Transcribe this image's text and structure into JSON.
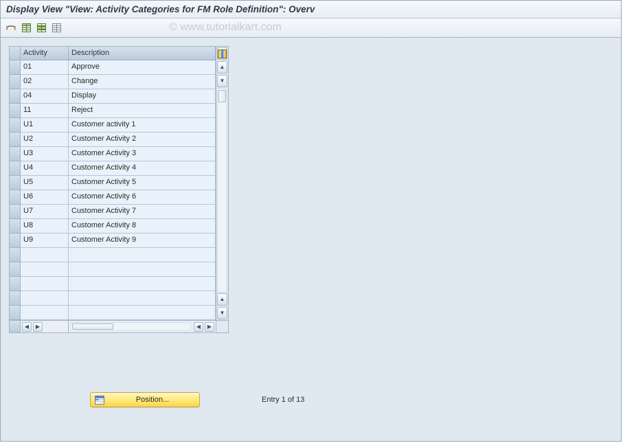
{
  "title": "Display View \"View: Activity Categories for FM Role Definition\": Overv",
  "watermark": "© www.tutorialkart.com",
  "toolbar": {
    "icons": [
      {
        "name": "toggle-display-change-icon"
      },
      {
        "name": "select-all-icon"
      },
      {
        "name": "deselect-all-icon"
      },
      {
        "name": "table-settings-icon"
      }
    ]
  },
  "table": {
    "columns": {
      "activity": "Activity",
      "description": "Description"
    },
    "rows": [
      {
        "activity": "01",
        "description": "Approve"
      },
      {
        "activity": "02",
        "description": "Change"
      },
      {
        "activity": "04",
        "description": "Display"
      },
      {
        "activity": "11",
        "description": "Reject"
      },
      {
        "activity": "U1",
        "description": "Customer activity 1"
      },
      {
        "activity": "U2",
        "description": "Customer Activity 2"
      },
      {
        "activity": "U3",
        "description": "Customer Activity 3"
      },
      {
        "activity": "U4",
        "description": "Customer Activity 4"
      },
      {
        "activity": "U5",
        "description": "Customer Activity 5"
      },
      {
        "activity": "U6",
        "description": "Customer Activity 6"
      },
      {
        "activity": "U7",
        "description": "Customer Activity 7"
      },
      {
        "activity": "U8",
        "description": "Customer Activity 8"
      },
      {
        "activity": "U9",
        "description": "Customer Activity 9"
      }
    ],
    "empty_rows": 5
  },
  "footer": {
    "position_label": "Position...",
    "entry_text": "Entry 1 of 13"
  }
}
